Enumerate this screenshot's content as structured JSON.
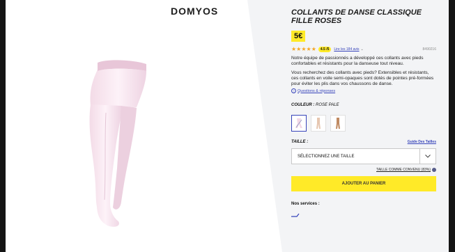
{
  "brand": "DOMYOS",
  "product": {
    "title": "COLLANTS DE DANSE CLASSIQUE FILLE ROSES",
    "price": "5€",
    "rating": {
      "stars": 4.5,
      "badge": "4.5 /5",
      "reviews_link": "Lire les 184 avis",
      "reference": "8490216"
    },
    "description_1": "Notre équipe de passionnés a développé ces collants avec pieds confortables et résistants pour la danseuse tout niveau.",
    "description_2": "Vous recherchez des collants avec pieds? Extensibles et résistants, ces collants en voile semi-opaques sont dotés de pointes pré-formées pour éviter les plis dans vos chaussons de danse.",
    "qa_link": "Questions & réponses",
    "color": {
      "label": "COULEUR :",
      "value": "ROSE PALE"
    },
    "size": {
      "label": "TAILLE :",
      "guide": "Guide Des Tailles",
      "select_value": "SÉLECTIONNEZ UNE TAILLE",
      "fit": "TAILLE COMME CONVENU (83%)"
    },
    "cart_button": "AJOUTER AU PANIER",
    "services_label": "Nos services :"
  },
  "colors": {
    "accent_yellow": "#ffea28",
    "link_blue": "#3643ba",
    "panel_bg": "#f3f4f6"
  }
}
